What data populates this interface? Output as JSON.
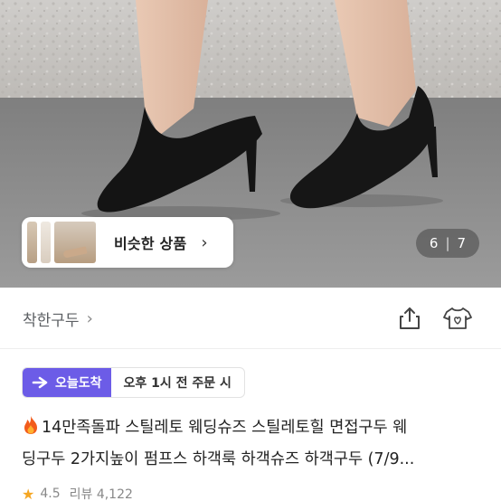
{
  "hero": {
    "similar_label": "비슷한 상품",
    "similar_chevron": "›",
    "counter_current": "6",
    "counter_separator": "|",
    "counter_total": "7"
  },
  "brand": {
    "name": "착한구두",
    "chevron": "›"
  },
  "delivery": {
    "badge_label": "오늘도착",
    "condition": "오후 1시 전 주문 시"
  },
  "product": {
    "title_line1": "14만족돌파 스틸레토 웨딩슈즈 스틸레토힐 면접구두 웨",
    "title_line2": "딩구두 2가지높이 펌프스 하객룩 하객슈즈 하객구두 (7/9..."
  },
  "rating": {
    "score": "4.5",
    "reviews": "리뷰 4,122"
  },
  "colors": {
    "accent": "#6c5ce7",
    "star": "#f5a623"
  },
  "icons": [
    "fire-icon",
    "share-icon",
    "heart-tshirt-icon",
    "chevron-right-icon",
    "star-icon"
  ]
}
